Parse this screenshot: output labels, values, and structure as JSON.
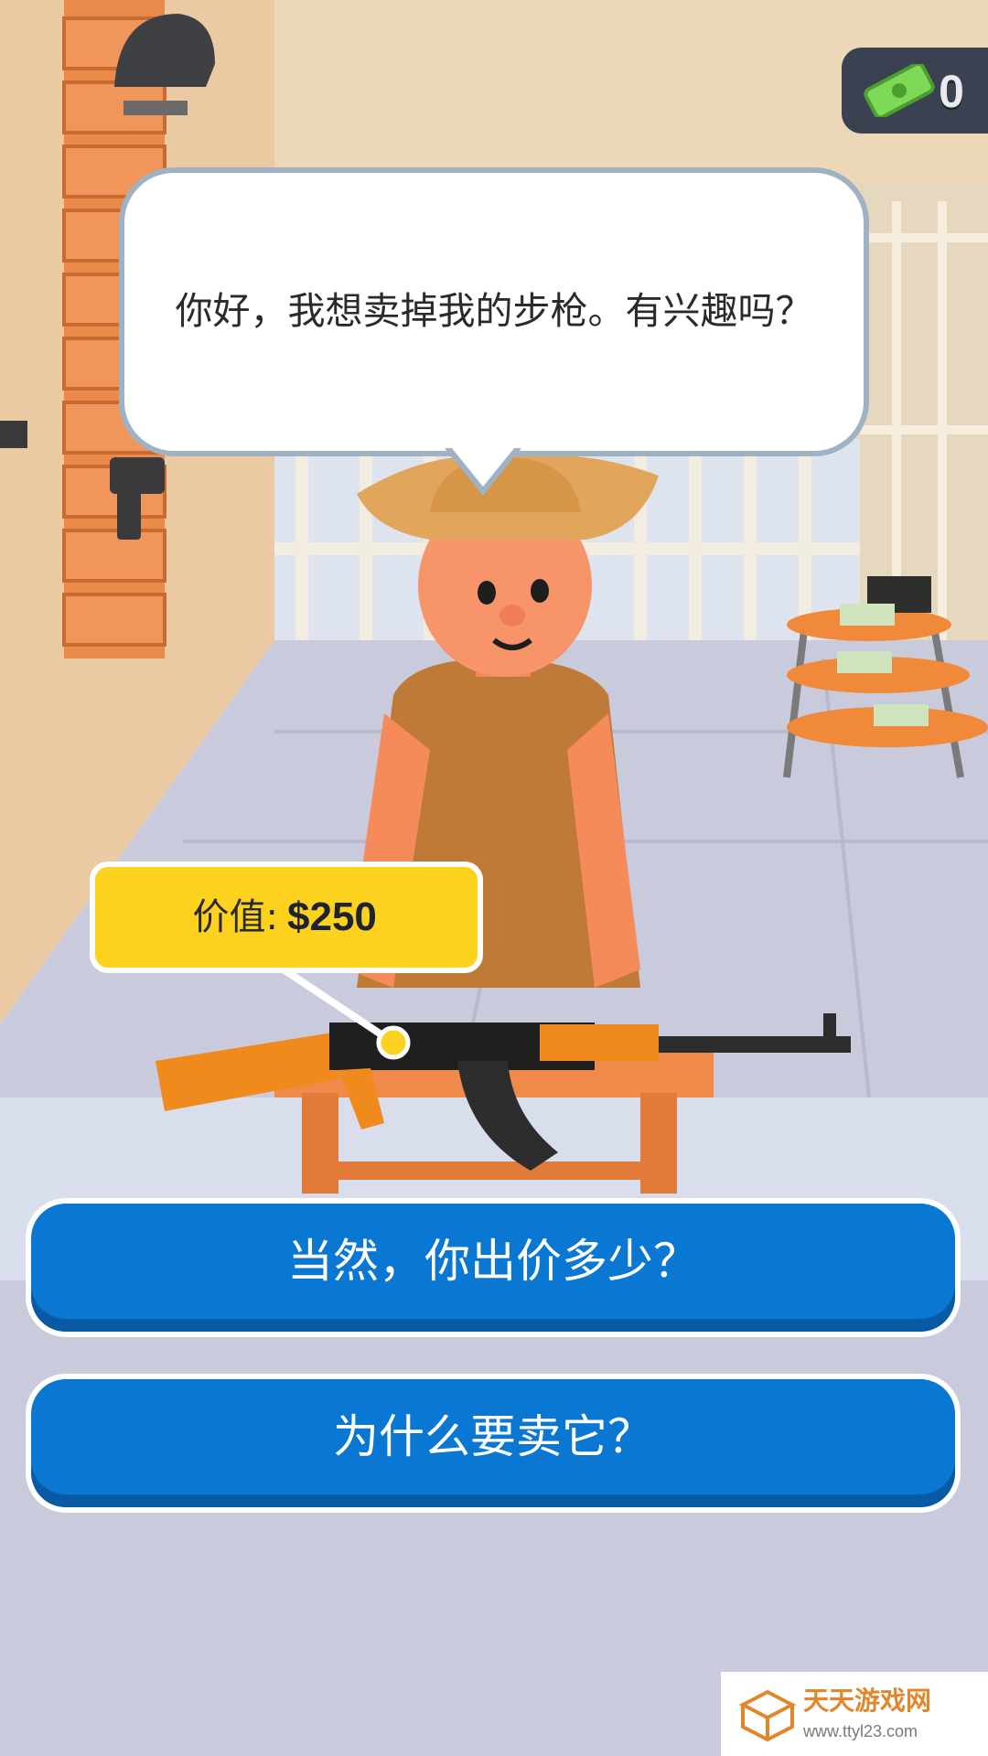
{
  "hud": {
    "cash_icon": "cash-icon",
    "cash_value": "0"
  },
  "dialogue": {
    "speech": "你好，我想卖掉我的步枪。有兴趣吗？"
  },
  "item": {
    "name_icon": "rifle",
    "value_label": "价值:",
    "value_amount": "$250"
  },
  "choices": [
    {
      "label": "当然，你出价多少？"
    },
    {
      "label": "为什么要卖它？"
    }
  ],
  "watermark": {
    "title": "天天游戏网",
    "url": "www.ttyl23.com"
  },
  "colors": {
    "button_blue": "#0a78d2",
    "tag_yellow": "#fdd21e",
    "hud_dark": "#3a4150",
    "cash_green": "#7ed957"
  }
}
